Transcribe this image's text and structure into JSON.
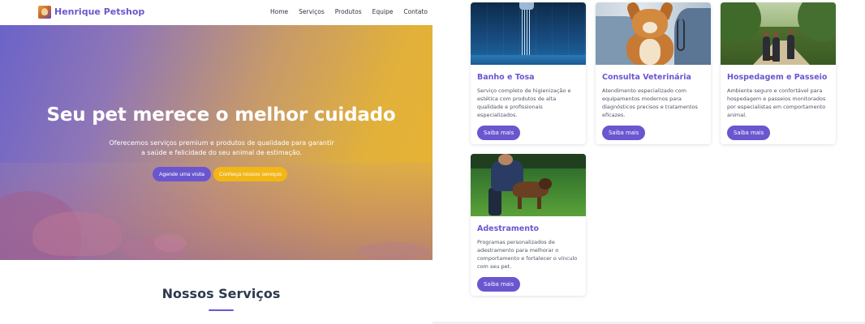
{
  "brand": {
    "name": "Henrique Petshop"
  },
  "nav": [
    "Home",
    "Serviços",
    "Produtos",
    "Equipe",
    "Contato"
  ],
  "hero": {
    "title": "Seu pet merece o melhor cuidado",
    "subtitle": "Oferecemos serviços premium e produtos de qualidade para garantir a saúde e felicidade do seu animal de estimação.",
    "primary_button": "Agende uma visita",
    "secondary_button": "Conheça nossos serviços"
  },
  "section": {
    "title": "Nossos Serviços"
  },
  "services": [
    {
      "title": "Banho e Tosa",
      "description": "Serviço completo de higienização e estética com produtos de alta qualidade e profissionais especializados.",
      "button": "Saiba mais"
    },
    {
      "title": "Consulta Veterinária",
      "description": "Atendimento especializado com equipamentos modernos para diagnósticos precisos e tratamentos eficazes.",
      "button": "Saiba mais"
    },
    {
      "title": "Hospedagem e Passeio",
      "description": "Ambiente seguro e confortável para hospedagem e passeios monitorados por especialistas em comportamento animal.",
      "button": "Saiba mais"
    },
    {
      "title": "Adestramento",
      "description": "Programas personalizados de adestramento para melhorar o comportamento e fortalecer o vínculo com seu pet.",
      "button": "Saiba mais"
    }
  ],
  "colors": {
    "accent": "#6a57cf",
    "secondary": "#f2b616",
    "heading": "#2d3a4e"
  }
}
